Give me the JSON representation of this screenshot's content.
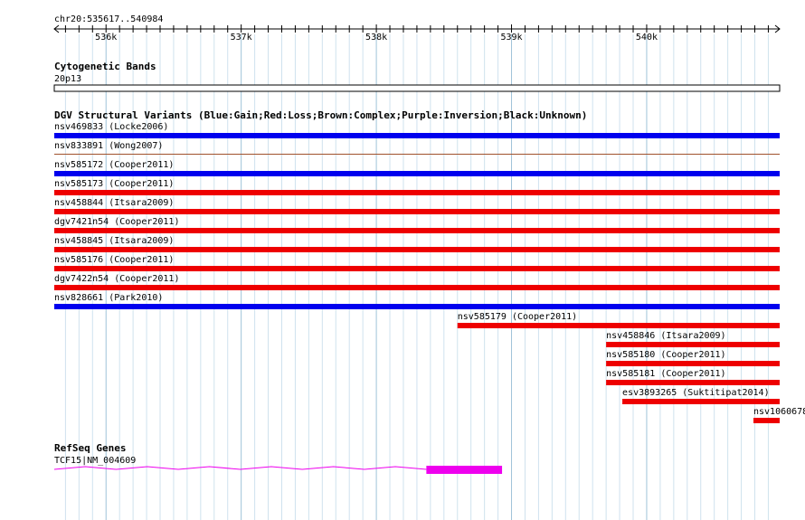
{
  "ruler": {
    "location": "chr20:535617..540984",
    "start": 535617,
    "end": 540984,
    "ticks": [
      {
        "pos": 536000,
        "label": "536k"
      },
      {
        "pos": 537000,
        "label": "537k"
      },
      {
        "pos": 538000,
        "label": "538k"
      },
      {
        "pos": 539000,
        "label": "539k"
      },
      {
        "pos": 540000,
        "label": "540k"
      }
    ]
  },
  "cytoband": {
    "title": "Cytogenetic Bands",
    "band": "20p13"
  },
  "dgv": {
    "title": "DGV Structural Variants (Blue:Gain;Red:Loss;Brown:Complex;Purple:Inversion;Black:Unknown)",
    "colors": {
      "gain": "#0000ee",
      "loss": "#ee0000",
      "complex": "#a0522d",
      "inversion": "#800080",
      "unknown": "#000000"
    },
    "features": [
      {
        "label": "nsv469833 (Locke2006)",
        "type": "gain",
        "start": 535617,
        "end": 540984
      },
      {
        "label": "nsv833891 (Wong2007)",
        "type": "complex",
        "start": 535617,
        "end": 540984
      },
      {
        "label": "nsv585172 (Cooper2011)",
        "type": "gain",
        "start": 535617,
        "end": 540984
      },
      {
        "label": "nsv585173 (Cooper2011)",
        "type": "loss",
        "start": 535617,
        "end": 540984
      },
      {
        "label": "nsv458844 (Itsara2009)",
        "type": "loss",
        "start": 535617,
        "end": 540984
      },
      {
        "label": "dgv7421n54 (Cooper2011)",
        "type": "loss",
        "start": 535617,
        "end": 540984
      },
      {
        "label": "nsv458845 (Itsara2009)",
        "type": "loss",
        "start": 535617,
        "end": 540984
      },
      {
        "label": "nsv585176 (Cooper2011)",
        "type": "loss",
        "start": 535617,
        "end": 540984
      },
      {
        "label": "dgv7422n54 (Cooper2011)",
        "type": "loss",
        "start": 535617,
        "end": 540984
      },
      {
        "label": "nsv828661 (Park2010)",
        "type": "gain",
        "start": 535617,
        "end": 540984
      },
      {
        "label": "nsv585179 (Cooper2011)",
        "type": "loss",
        "start": 538600,
        "end": 540984
      },
      {
        "label": "nsv458846 (Itsara2009)",
        "type": "loss",
        "start": 539700,
        "end": 540984
      },
      {
        "label": "nsv585180 (Cooper2011)",
        "type": "loss",
        "start": 539700,
        "end": 540984
      },
      {
        "label": "nsv585181 (Cooper2011)",
        "type": "loss",
        "start": 539700,
        "end": 540984
      },
      {
        "label": "esv3893265 (Suktitipat2014)",
        "type": "loss",
        "start": 539820,
        "end": 540984
      },
      {
        "label": "nsv1060678",
        "type": "loss",
        "start": 540790,
        "end": 540984
      }
    ]
  },
  "refseq": {
    "title": "RefSeq Genes",
    "gene_label": "TCF15|NM_004609",
    "color": "#ee00ee",
    "intron_start": 535617,
    "intron_end": 538370,
    "exon_start": 538370,
    "exon_end": 538930
  }
}
